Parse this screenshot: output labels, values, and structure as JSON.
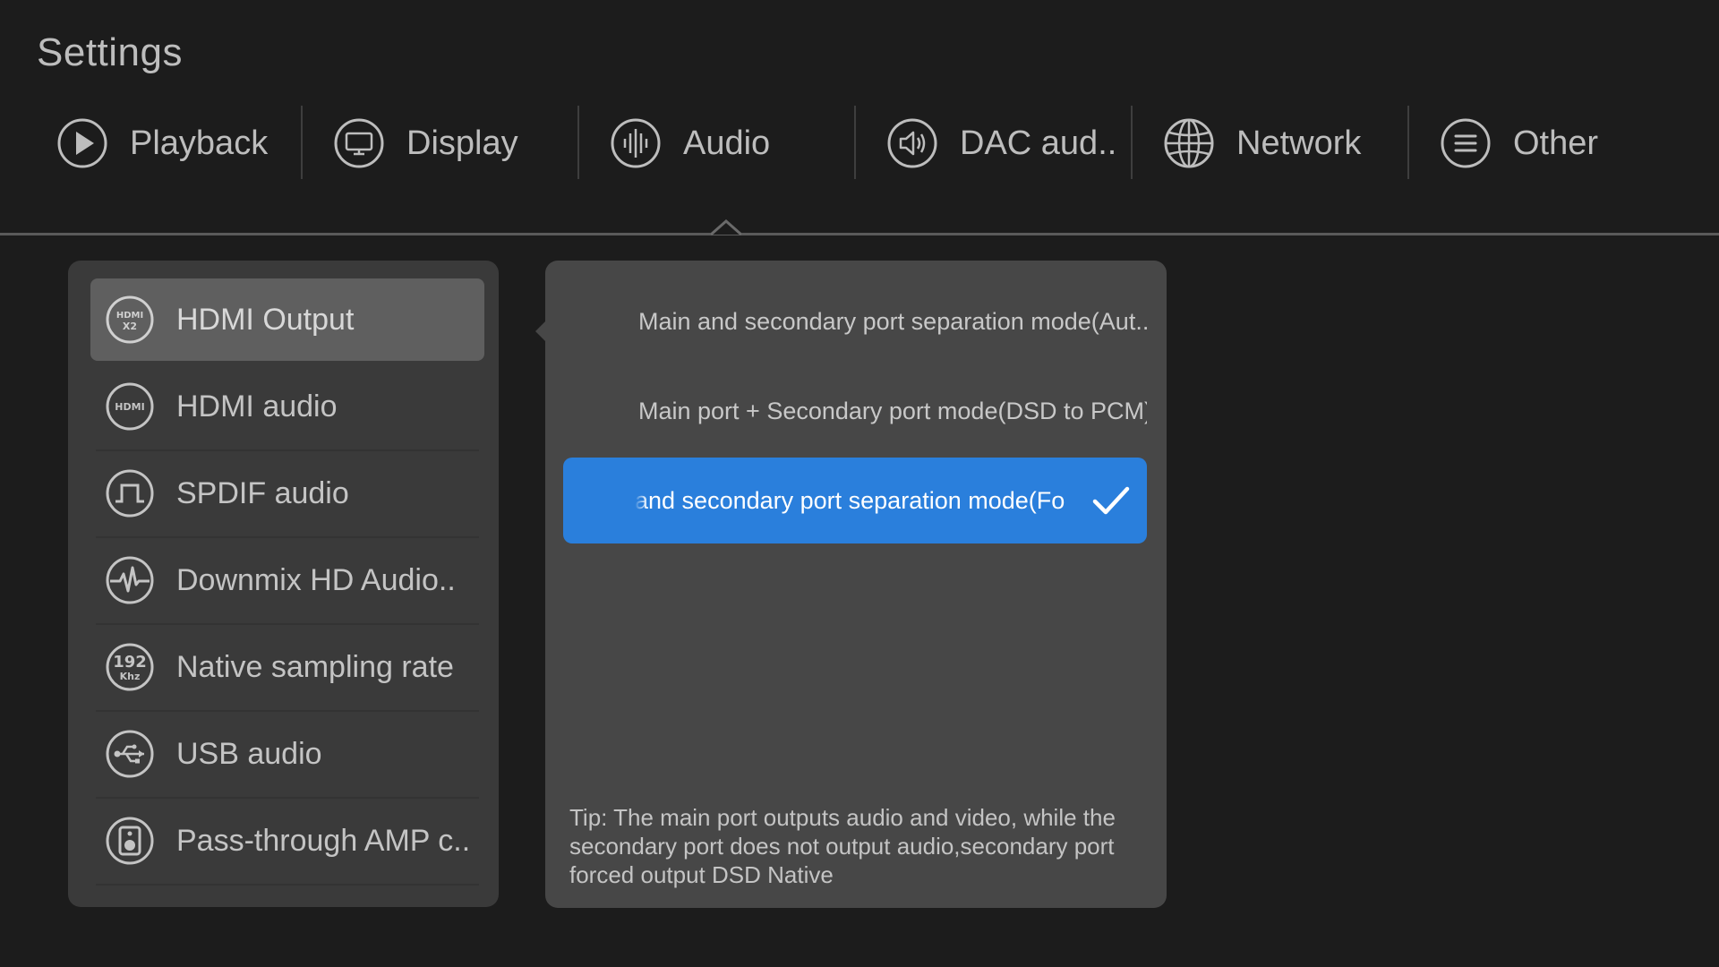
{
  "header": {
    "title": "Settings"
  },
  "tabs": [
    {
      "label": "Playback",
      "icon": "play-icon"
    },
    {
      "label": "Display",
      "icon": "monitor-icon"
    },
    {
      "label": "Audio",
      "icon": "audio-wave-icon",
      "active": true
    },
    {
      "label": "DAC aud..",
      "icon": "speaker-icon"
    },
    {
      "label": "Network",
      "icon": "globe-icon"
    },
    {
      "label": "Other",
      "icon": "menu-lines-icon"
    }
  ],
  "audio_menu": {
    "items": [
      {
        "label": "HDMI Output",
        "icon": "hdmi-x2-icon",
        "selected": true
      },
      {
        "label": "HDMI audio",
        "icon": "hdmi-icon"
      },
      {
        "label": "SPDIF audio",
        "icon": "spdif-pulse-icon"
      },
      {
        "label": "Downmix HD Audio..",
        "icon": "waveform-icon"
      },
      {
        "label": "Native sampling rate",
        "icon": "192khz-icon",
        "icon_text_top": "192",
        "icon_text_bottom": "Khz"
      },
      {
        "label": "USB audio",
        "icon": "usb-icon"
      },
      {
        "label": "Pass-through AMP c..",
        "icon": "amp-speaker-icon"
      }
    ]
  },
  "hdmi_icon_text": {
    "top": "HDMI",
    "x2": "X2"
  },
  "options": {
    "items": [
      {
        "label": "Main and secondary port separation mode(Aut.."
      },
      {
        "label": "Main port + Secondary port mode(DSD to PCM)"
      },
      {
        "label": "and secondary port separation mode(Fo",
        "selected": true
      }
    ],
    "tip": "Tip: The main port outputs audio and video, while the secondary port does not output audio,secondary port forced output DSD Native"
  },
  "colors": {
    "background": "#1c1c1c",
    "left_panel": "#3a3a3a",
    "right_panel": "#474747",
    "selected_menu": "#5f5f5f",
    "accent_blue": "#2a7fdc"
  }
}
